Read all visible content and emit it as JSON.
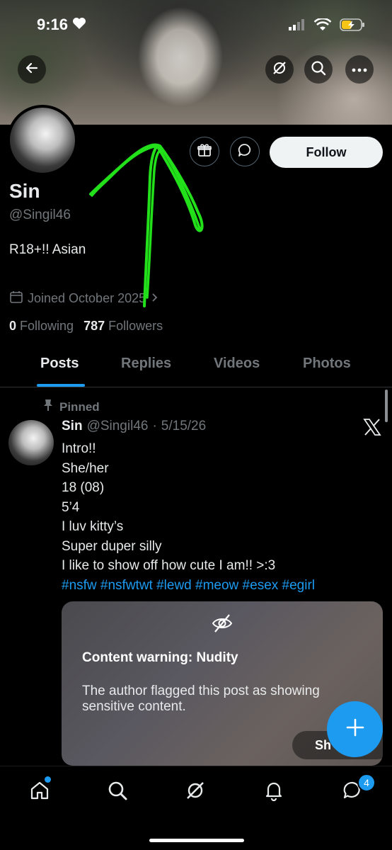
{
  "status_bar": {
    "time": "9:16"
  },
  "profile": {
    "name": "Sin",
    "handle": "@Singil46",
    "bio": "R18+!! Asian",
    "joined": "Joined October 2025",
    "following_count": "0",
    "following_label": "Following",
    "followers_count": "787",
    "followers_label": "Followers",
    "follow_label": "Follow"
  },
  "tabs": [
    {
      "label": "Posts",
      "active": true
    },
    {
      "label": "Replies",
      "active": false
    },
    {
      "label": "Videos",
      "active": false
    },
    {
      "label": "Photos",
      "active": false
    }
  ],
  "post": {
    "pinned_label": "Pinned",
    "author": "Sin",
    "handle": "@Singil46",
    "separator": "·",
    "date": "5/15/26",
    "lines": [
      "Intro!!",
      "She/her",
      "18 (08)",
      "5’4",
      "I luv kitty’s",
      "Super duper silly",
      "I like to show off how cute I am!! >:3"
    ],
    "hashtags": "#nsfw #nsfwtwt #lewd #meow #esex #egirl",
    "warning": {
      "title": "Content warning: Nudity",
      "text": "The author flagged this post as showing sensitive content.",
      "show_label": "Sh"
    }
  },
  "nav": {
    "messages_badge": "4"
  },
  "colors": {
    "accent": "#1d9bf0",
    "annotation_arrow": "#22e01a",
    "muted": "#71767b"
  },
  "icons": [
    "back-arrow-icon",
    "grok-icon",
    "search-icon",
    "more-icon",
    "gift-icon",
    "message-icon",
    "calendar-icon",
    "pin-icon",
    "x-logo-icon",
    "eye-off-icon",
    "plus-icon",
    "home-icon",
    "explore-icon",
    "grok-nav-icon",
    "notifications-icon",
    "messages-icon"
  ]
}
